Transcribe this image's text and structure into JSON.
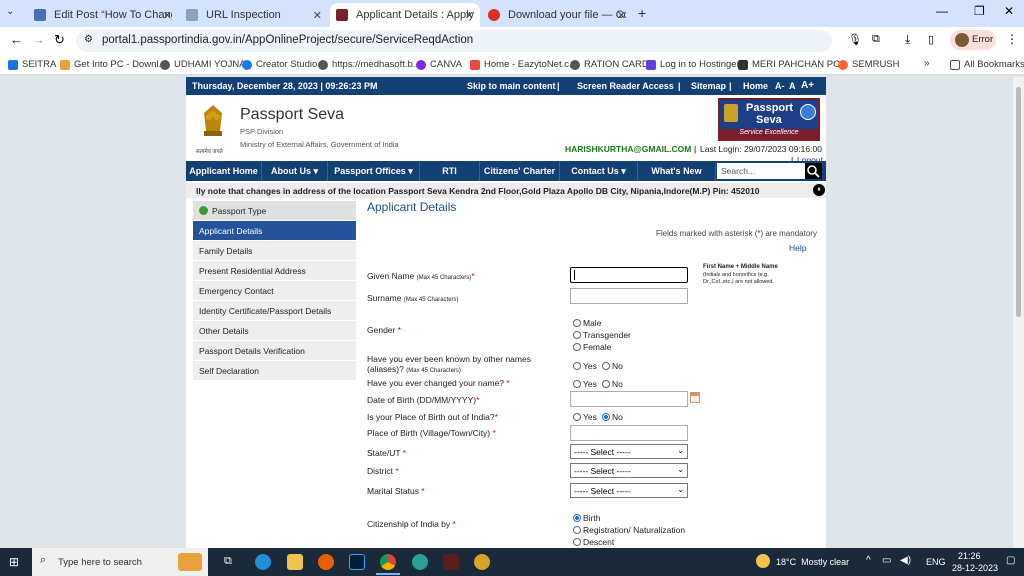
{
  "browser": {
    "tabs": [
      {
        "title": "Edit Post “How To Change Tatk",
        "color": "#4a6fb8"
      },
      {
        "title": "URL Inspection",
        "color": "#8aa1c5"
      },
      {
        "title": "Applicant Details : Apply for Fre",
        "color": "#7b1f2e"
      },
      {
        "title": "Download your file — Converti",
        "color": "#d93025"
      }
    ],
    "url": "portal1.passportindia.gov.in/AppOnlineProject/secure/ServiceReqdAction",
    "profile_label": "Error",
    "bookmarks": [
      {
        "label": "SEITRA",
        "color": "#1a73e8"
      },
      {
        "label": "Get Into PC - Downl...",
        "color": "#e8a33d"
      },
      {
        "label": "UDHAMI YOJNA",
        "color": "#555"
      },
      {
        "label": "Creator Studio",
        "color": "#1877f2"
      },
      {
        "label": "https://medhasoft.b...",
        "color": "#555"
      },
      {
        "label": "CANVA",
        "color": "#7d2ae8"
      },
      {
        "label": "Home - EazytoNet.c...",
        "color": "#e44"
      },
      {
        "label": "RATION CARD",
        "color": "#555"
      },
      {
        "label": "Log in to Hostinger",
        "color": "#673de6"
      },
      {
        "label": "MERI PAHCHAN PO...",
        "color": "#333"
      },
      {
        "label": "SEMRUSH",
        "color": "#ff642d"
      }
    ],
    "all_bookmarks": "All Bookmarks"
  },
  "site": {
    "datetime": "Thursday, December  28, 2023 | 09:26:23 PM",
    "skip": "Skip to main content",
    "screen_reader": "Screen Reader Access",
    "sitemap": "Sitemap",
    "home": "Home",
    "font_sizes": [
      "A-",
      "A",
      "A+"
    ],
    "title": "Passport Seva",
    "division": "PSP Division",
    "ministry": "Ministry of External Affairs, Government of India",
    "emblem_text": "सत्यमेव जयते",
    "logo_line1": "Passport",
    "logo_line2": "Seva",
    "logo_tag": "Service Excellence",
    "user_email": "HARISHKURTHA@GMAIL.COM",
    "last_login": "Last Login: 29/07/2023 09:16:00",
    "logout": "Logout",
    "nav": [
      "Applicant Home",
      "About Us ▾",
      "Passport Offices ▾",
      "RTI",
      "Citizens' Charter",
      "Contact Us ▾",
      "What's New"
    ],
    "search_placeholder": "Search...",
    "ticker": "lly note that changes in address of the location Passport Seva Kendra 2nd Floor,Gold Plaza Apollo DB City, Nipania,Indore(M.P) Pin: 452010",
    "sidebar": [
      "Passport Type",
      "Applicant Details",
      "Family Details",
      "Present Residential Address",
      "Emergency Contact",
      "Identity Certificate/Passport Details",
      "Other Details",
      "Passport Details Verification",
      "Self Declaration"
    ]
  },
  "form": {
    "heading": "Applicant Details",
    "mandatory_note": "Fields marked with asterisk (*) are mandatory",
    "help": "Help",
    "given_name": "Given Name",
    "given_name_hint": "(Max 45 Characters)",
    "name_note_title": "First Name + Middle Name",
    "name_note": "(Initials and honorifics (e.g. Dr.,Col.,etc.) are not allowed.",
    "surname": "Surname",
    "surname_hint": "(Max 45 Characters)",
    "gender": "Gender",
    "gender_options": [
      "Male",
      "Transgender",
      "Female"
    ],
    "aliases_q1": "Have you ever been known by other names",
    "aliases_q2": "(aliases)?",
    "aliases_hint": "(Max 45 Characters)",
    "changed_name_q": "Have you ever changed your name?",
    "yes": "Yes",
    "no": "No",
    "dob": "Date of Birth (DD/MM/YYYY)",
    "pob_out_q": "Is your Place of Birth out of India?",
    "pob": "Place of Birth (Village/Town/City)",
    "state": "State/UT",
    "district": "District",
    "marital": "Marital Status",
    "select": "----- Select -----",
    "citizenship": "Citizenship of India by",
    "citizenship_options": [
      "Birth",
      "Registration/ Naturalization",
      "Descent"
    ]
  },
  "taskbar": {
    "search": "Type here to search",
    "weather": "18°C  Mostly clear",
    "lang": "ENG",
    "time": "21:26",
    "date": "28-12-2023"
  }
}
